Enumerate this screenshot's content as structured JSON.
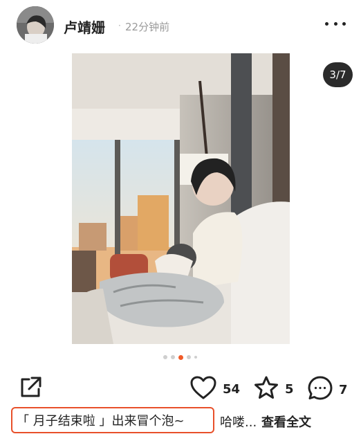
{
  "post": {
    "author": "卢靖姗",
    "dot": "·",
    "time": "22分钟前",
    "image_counter": "3/7",
    "carousel": {
      "total": 5,
      "active_index": 2
    }
  },
  "actions": {
    "like_count": "54",
    "favorite_count": "5",
    "comment_count": "7"
  },
  "caption": {
    "highlighted": "「 月子结束啦 」出来冒个泡~",
    "rest": "哈喽...",
    "read_more": "查看全文"
  },
  "colors": {
    "accent": "#e8502a",
    "dot_active": "#f05a28",
    "counter_bg": "#2b2b2b"
  },
  "icons": [
    "more-icon",
    "share-icon",
    "heart-icon",
    "star-icon",
    "comment-icon"
  ]
}
